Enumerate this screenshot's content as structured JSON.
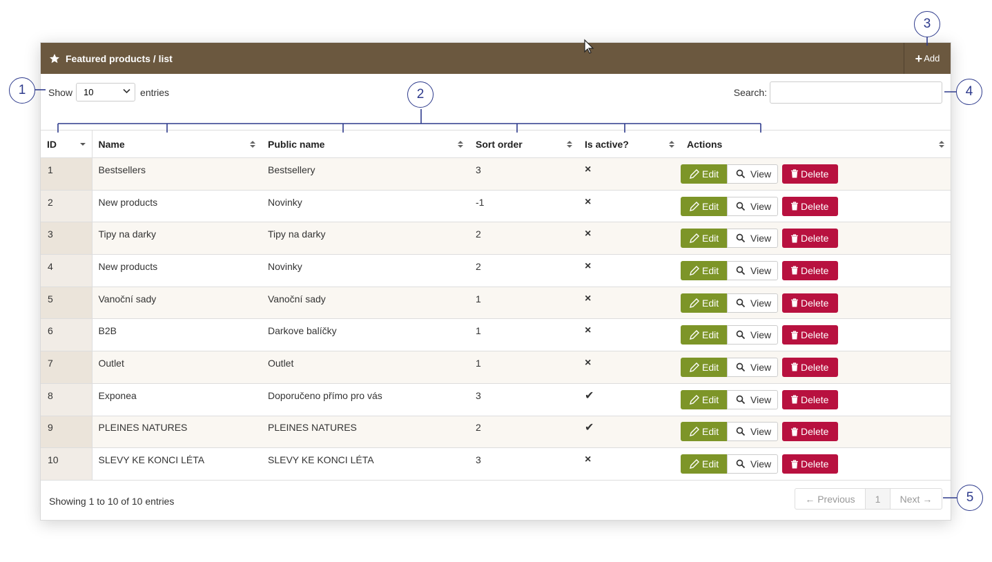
{
  "panel": {
    "title": "Featured products / list",
    "add_label": "Add"
  },
  "length": {
    "prefix": "Show",
    "value": "10",
    "suffix": "entries"
  },
  "search": {
    "label": "Search:",
    "value": ""
  },
  "columns": [
    "ID",
    "Name",
    "Public name",
    "Sort order",
    "Is active?",
    "Actions"
  ],
  "actions": {
    "edit": "Edit",
    "view": "View",
    "delete": "Delete"
  },
  "rows": [
    {
      "id": "1",
      "name": "Bestsellers",
      "public_name": "Bestsellery",
      "sort": "3",
      "active": "×"
    },
    {
      "id": "2",
      "name": "New products",
      "public_name": "Novinky",
      "sort": "-1",
      "active": "×"
    },
    {
      "id": "3",
      "name": "Tipy na darky",
      "public_name": "Tipy na darky",
      "sort": "2",
      "active": "×"
    },
    {
      "id": "4",
      "name": "New products",
      "public_name": "Novinky",
      "sort": "2",
      "active": "×"
    },
    {
      "id": "5",
      "name": "Vanoční sady",
      "public_name": "Vanoční sady",
      "sort": "1",
      "active": "×"
    },
    {
      "id": "6",
      "name": "B2B",
      "public_name": "Darkove balíčky",
      "sort": "1",
      "active": "×"
    },
    {
      "id": "7",
      "name": "Outlet",
      "public_name": "Outlet",
      "sort": "1",
      "active": "×"
    },
    {
      "id": "8",
      "name": "Exponea",
      "public_name": "Doporučeno přímo pro vás",
      "sort": "3",
      "active": "✔"
    },
    {
      "id": "9",
      "name": "PLEINES NATURES",
      "public_name": "PLEINES NATURES",
      "sort": "2",
      "active": "✔"
    },
    {
      "id": "10",
      "name": "SLEVY KE KONCI LÉTA",
      "public_name": "SLEVY KE KONCI LÉTA",
      "sort": "3",
      "active": "×"
    }
  ],
  "footer": {
    "info": "Showing 1 to 10 of 10 entries",
    "prev": "← Previous",
    "page": "1",
    "next": "Next →"
  },
  "callouts": [
    "1",
    "2",
    "3",
    "4",
    "5"
  ],
  "colors": {
    "header": "#6b583f",
    "edit": "#7d9528",
    "delete": "#b8113f",
    "callout": "#2d3a8c"
  }
}
